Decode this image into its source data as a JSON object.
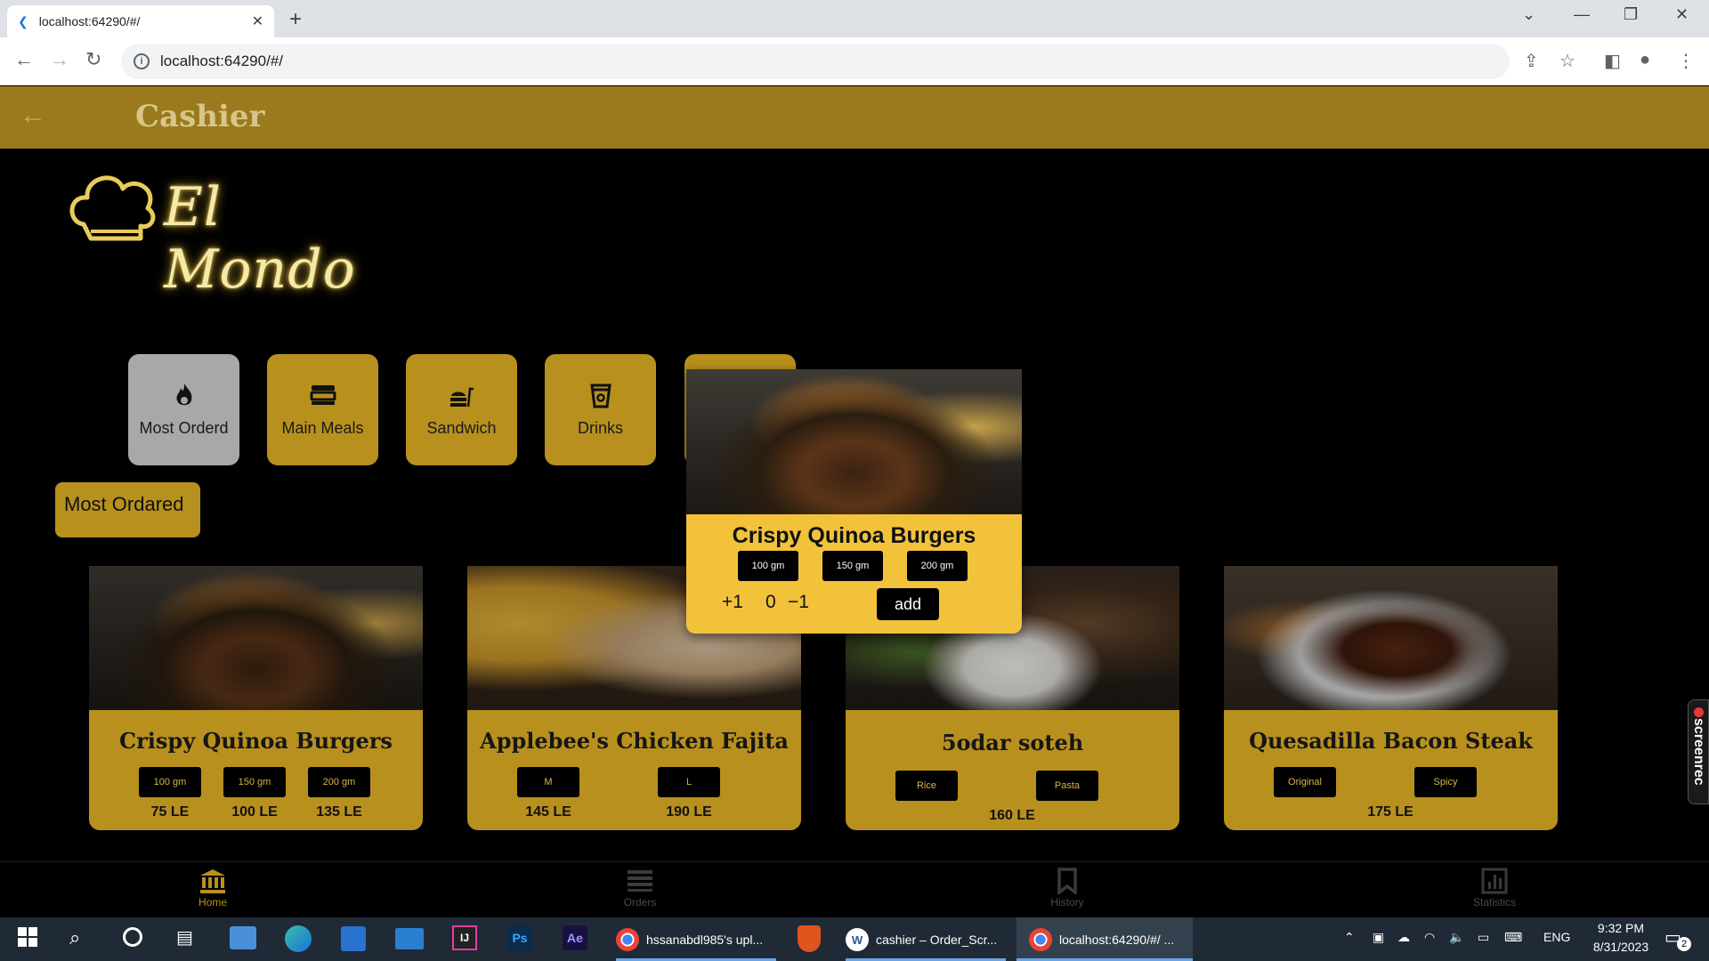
{
  "browser": {
    "tab_title": "localhost:64290/#/",
    "url": "localhost:64290/#/"
  },
  "app": {
    "title": "Cashier",
    "logo_text": "El Mondo"
  },
  "categories": [
    {
      "label": "Most Orderd",
      "icon": "fire-icon",
      "active": true
    },
    {
      "label": "Main Meals",
      "icon": "meal-tray-icon"
    },
    {
      "label": "Sandwich",
      "icon": "fastfood-icon"
    },
    {
      "label": "Drinks",
      "icon": "cup-icon"
    }
  ],
  "section_title": "Most Ordared",
  "products": [
    {
      "name": "Crispy Quinoa Burgers",
      "options": [
        "100 gm",
        "150 gm",
        "200 gm"
      ],
      "prices": [
        "75 LE",
        "100 LE",
        "135 LE"
      ]
    },
    {
      "name": "Applebee's Chicken Fajita",
      "options": [
        "M",
        "L"
      ],
      "prices": [
        "145 LE",
        "190 LE"
      ]
    },
    {
      "name": "5odar soteh",
      "options": [
        "Rice",
        "Pasta"
      ],
      "prices": [
        "160 LE"
      ]
    },
    {
      "name": "Quesadilla Bacon Steak",
      "options": [
        "Original",
        "Spicy"
      ],
      "prices": [
        "175 LE"
      ]
    }
  ],
  "popup": {
    "name": "Crispy Quinoa Burgers",
    "options": [
      "100 gm",
      "150 gm",
      "200 gm"
    ],
    "plus": "+1",
    "quantity": "0",
    "minus": "−1",
    "add_label": "add"
  },
  "bottom_nav": [
    {
      "label": "Home",
      "icon": "bank-icon",
      "active": true
    },
    {
      "label": "Orders",
      "icon": "list-icon"
    },
    {
      "label": "History",
      "icon": "bookmark-icon"
    },
    {
      "label": "Statistics",
      "icon": "chart-icon"
    }
  ],
  "screenrec_label": "screenrec",
  "taskbar": {
    "apps": [
      {
        "label": "hssanabdl985's upl...",
        "icon": "chrome-icon"
      },
      {
        "label": "cashier – Order_Scr...",
        "icon": "word-icon"
      },
      {
        "label": "localhost:64290/#/ ...",
        "icon": "chrome-icon"
      }
    ],
    "lang": "ENG",
    "time": "9:32 PM",
    "date": "8/31/2023",
    "notifications": "2"
  },
  "colors": {
    "gold": "#b8901d",
    "appbar": "#9a7a1c",
    "popup": "#f2c23a",
    "active_category": "#a8a8a8"
  }
}
